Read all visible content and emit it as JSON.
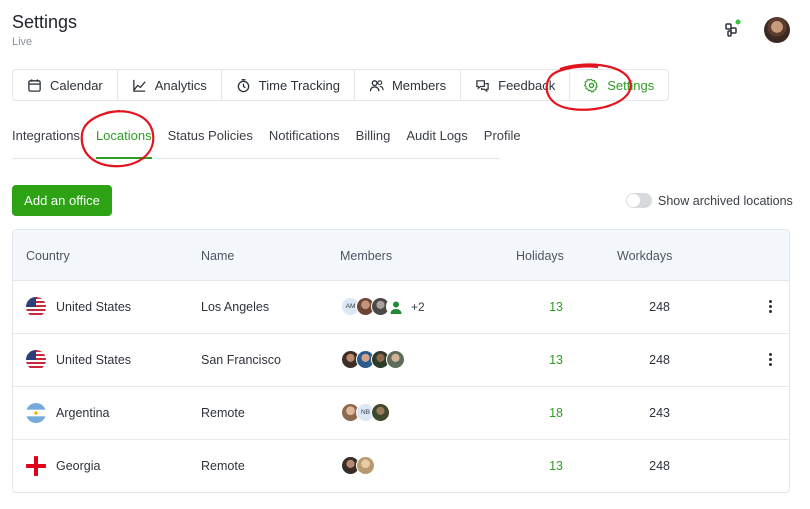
{
  "header": {
    "title": "Settings",
    "subtitle": "Live"
  },
  "tabs": [
    {
      "label": "Calendar",
      "icon": "calendar-icon"
    },
    {
      "label": "Analytics",
      "icon": "chart-line-icon"
    },
    {
      "label": "Time Tracking",
      "icon": "clock-icon"
    },
    {
      "label": "Members",
      "icon": "users-icon"
    },
    {
      "label": "Feedback",
      "icon": "chat-bubbles-icon"
    },
    {
      "label": "Settings",
      "icon": "gear-icon",
      "active": true
    }
  ],
  "subnav": [
    {
      "label": "Integrations"
    },
    {
      "label": "Locations",
      "active": true
    },
    {
      "label": "Status Policies"
    },
    {
      "label": "Notifications"
    },
    {
      "label": "Billing"
    },
    {
      "label": "Audit Logs"
    },
    {
      "label": "Profile"
    }
  ],
  "actions": {
    "add_office": "Add an office",
    "show_archived": "Show archived locations",
    "show_archived_on": false
  },
  "table": {
    "headers": {
      "country": "Country",
      "name": "Name",
      "members": "Members",
      "holidays": "Holidays",
      "workdays": "Workdays"
    },
    "rows": [
      {
        "flag": "us-flag-icon",
        "country": "United States",
        "name": "Los Angeles",
        "members": [
          "AM",
          "",
          "",
          ""
        ],
        "extra": "+2",
        "holidays": "13",
        "workdays": "248",
        "menu": true
      },
      {
        "flag": "us-flag-icon",
        "country": "United States",
        "name": "San Francisco",
        "members": [
          "",
          "",
          "",
          ""
        ],
        "extra": "",
        "holidays": "13",
        "workdays": "248",
        "menu": true
      },
      {
        "flag": "argentina-flag-icon",
        "country": "Argentina",
        "name": "Remote",
        "members": [
          "",
          "NB",
          ""
        ],
        "extra": "",
        "holidays": "18",
        "workdays": "243",
        "menu": false
      },
      {
        "flag": "georgia-flag-icon",
        "country": "Georgia",
        "name": "Remote",
        "members": [
          "",
          ""
        ],
        "extra": "",
        "holidays": "13",
        "workdays": "248",
        "menu": false
      }
    ]
  },
  "colors": {
    "accent": "#2e9d25",
    "annotation": "#e3141e",
    "header_bg": "#f4f8fd"
  }
}
